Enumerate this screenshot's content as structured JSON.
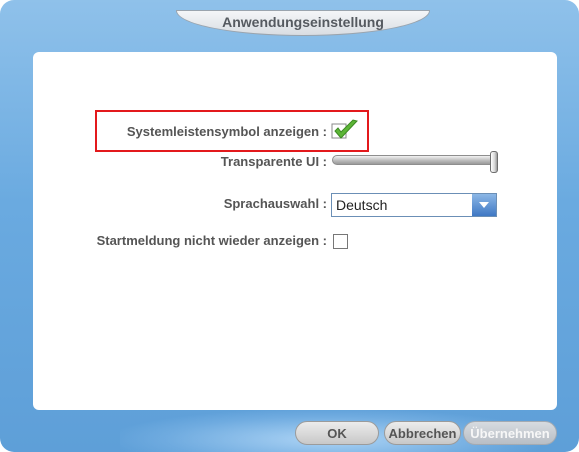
{
  "window": {
    "title": "Anwendungseinstellung"
  },
  "settings": {
    "tray_icon_label": "Systemleistensymbol anzeigen :",
    "tray_icon_checked": true,
    "transparency_label": "Transparente UI :",
    "transparency_value": 1.0,
    "language_label": "Sprachauswahl :",
    "language_value": "Deutsch",
    "startup_message_label": "Startmeldung nicht wieder anzeigen :",
    "startup_message_checked": false
  },
  "buttons": {
    "ok": "OK",
    "cancel": "Abbrechen",
    "apply": "Übernehmen"
  },
  "colors": {
    "highlight": "#e3191c",
    "check_green": "#5cb536",
    "window_blue": "#6aaae0"
  },
  "icons": {
    "checked": "checkmark-icon",
    "dropdown": "chevron-down-icon"
  }
}
